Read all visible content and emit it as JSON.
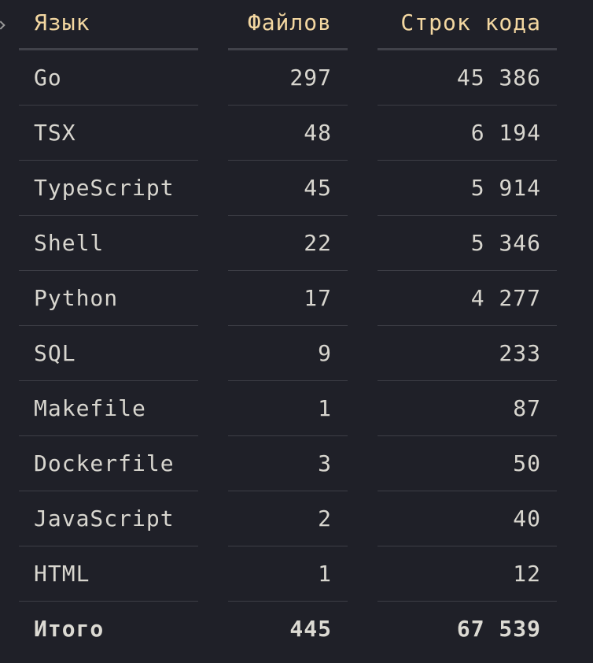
{
  "table": {
    "headers": [
      "Язык",
      "Файлов",
      "Строк кода"
    ],
    "rows": [
      {
        "language": "Go",
        "files": "297",
        "lines": "45 386"
      },
      {
        "language": "TSX",
        "files": "48",
        "lines": "6 194"
      },
      {
        "language": "TypeScript",
        "files": "45",
        "lines": "5 914"
      },
      {
        "language": "Shell",
        "files": "22",
        "lines": "5 346"
      },
      {
        "language": "Python",
        "files": "17",
        "lines": "4 277"
      },
      {
        "language": "SQL",
        "files": "9",
        "lines": "233"
      },
      {
        "language": "Makefile",
        "files": "1",
        "lines": "87"
      },
      {
        "language": "Dockerfile",
        "files": "3",
        "lines": "50"
      },
      {
        "language": "JavaScript",
        "files": "2",
        "lines": "40"
      },
      {
        "language": "HTML",
        "files": "1",
        "lines": "12"
      }
    ],
    "total": {
      "label": "Итого",
      "files": "445",
      "lines": "67 539"
    }
  },
  "colors": {
    "background": "#1f2028",
    "header_text": "#f3d7a1",
    "body_text": "#d8d6cf",
    "row_divider": "#3d3e46"
  }
}
